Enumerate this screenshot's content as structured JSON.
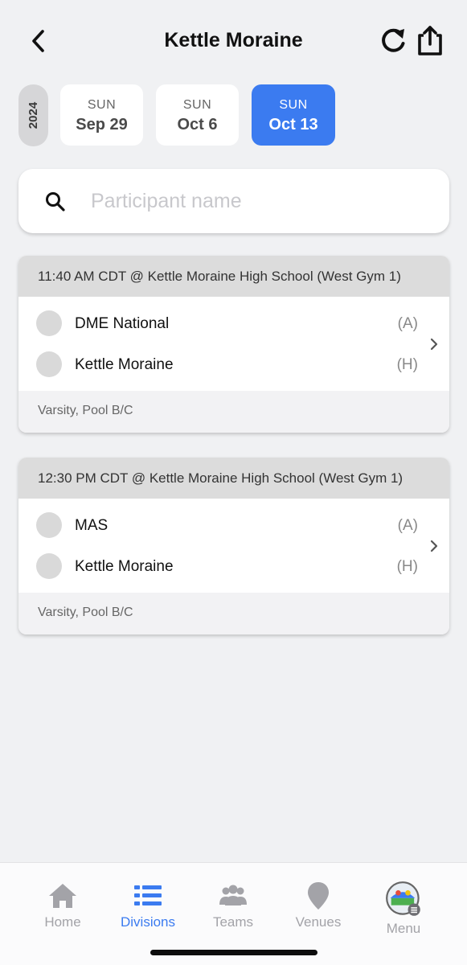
{
  "header": {
    "title": "Kettle Moraine",
    "back_icon": "chevron-left-icon",
    "refresh_icon": "refresh-icon",
    "share_icon": "share-icon"
  },
  "date_selector": {
    "year": "2024",
    "dates": [
      {
        "dow": "SUN",
        "date": "Sep 29",
        "selected": false
      },
      {
        "dow": "SUN",
        "date": "Oct 6",
        "selected": false
      },
      {
        "dow": "SUN",
        "date": "Oct 13",
        "selected": true
      }
    ]
  },
  "search": {
    "placeholder": "Participant name",
    "value": ""
  },
  "games": [
    {
      "header": "11:40 AM CDT @ Kettle Moraine High School (West Gym 1)",
      "teams": [
        {
          "name": "DME National",
          "side": "(A)"
        },
        {
          "name": "Kettle Moraine",
          "side": "(H)"
        }
      ],
      "footer": "Varsity, Pool B/C"
    },
    {
      "header": "12:30 PM CDT @ Kettle Moraine High School (West Gym 1)",
      "teams": [
        {
          "name": "MAS",
          "side": "(A)"
        },
        {
          "name": "Kettle Moraine",
          "side": "(H)"
        }
      ],
      "footer": "Varsity, Pool B/C"
    }
  ],
  "bottom_nav": {
    "items": [
      {
        "label": "Home",
        "icon": "home-icon",
        "active": false
      },
      {
        "label": "Divisions",
        "icon": "divisions-list-icon",
        "active": true
      },
      {
        "label": "Teams",
        "icon": "teams-icon",
        "active": false
      },
      {
        "label": "Venues",
        "icon": "map-pin-icon",
        "active": false
      },
      {
        "label": "Menu",
        "icon": "menu-avatar-icon",
        "active": false
      }
    ]
  },
  "colors": {
    "accent": "#3b7bf0",
    "background": "#f0f1f3",
    "inactive_nav": "#a3a3a8"
  }
}
